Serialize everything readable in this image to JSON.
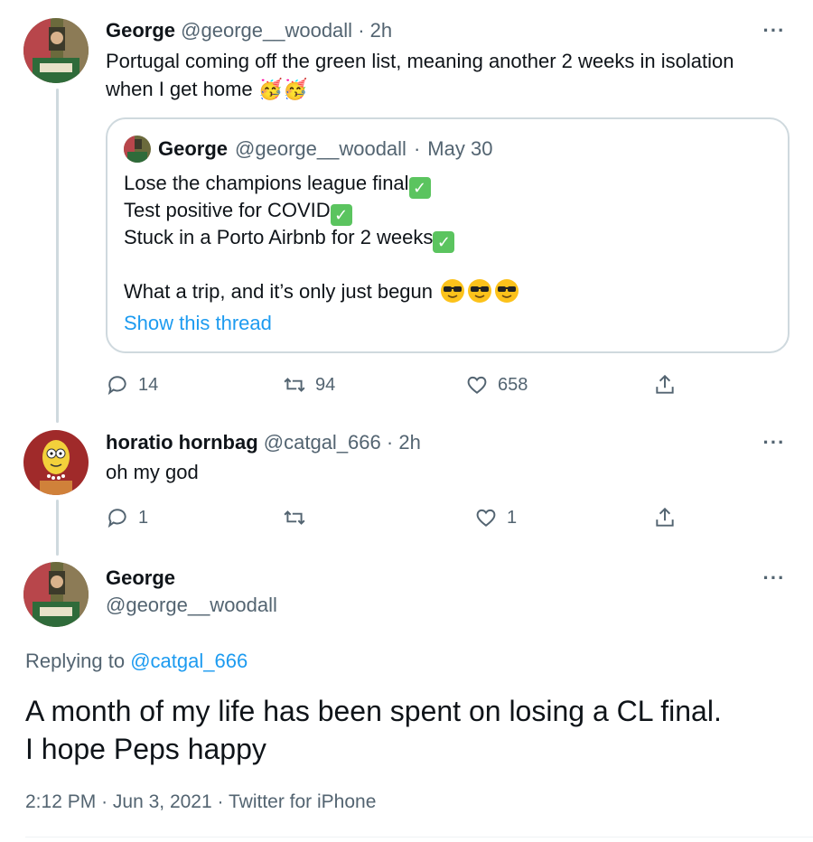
{
  "tweet1": {
    "name": "George",
    "handle": "@george__woodall",
    "time": "2h",
    "text_line1": "Portugal coming off the green list, meaning another 2 weeks in isolation",
    "text_line2": "when I get home",
    "emoji": "🥳🥳",
    "quoted": {
      "name": "George",
      "handle": "@george__woodall",
      "date": "May 30",
      "lines": [
        "Lose the champions league final",
        "Test positive for COVID",
        "Stuck in a Porto Airbnb for 2 weeks",
        "What a trip, and it’s only just begun"
      ],
      "show_thread": "Show this thread"
    },
    "replies": "14",
    "retweets": "94",
    "likes": "658"
  },
  "tweet2": {
    "name": "horatio hornbag",
    "handle": "@catgal_666",
    "time": "2h",
    "text": "oh my god",
    "replies": "1",
    "retweets": "",
    "likes": "1"
  },
  "tweet3": {
    "name": "George",
    "handle": "@george__woodall",
    "replying_prefix": "Replying to",
    "replying_handle": "@catgal_666",
    "text_line1": "A month of my life has been spent on losing a CL final.",
    "text_line2": "I hope Peps happy",
    "time": "2:12 PM",
    "date": "Jun 3, 2021",
    "client": "Twitter for iPhone"
  },
  "separator": "·",
  "colors": {
    "link": "#1d9bf0",
    "muted": "#536471",
    "border": "#cfd9de",
    "check": "#5bc45f"
  }
}
